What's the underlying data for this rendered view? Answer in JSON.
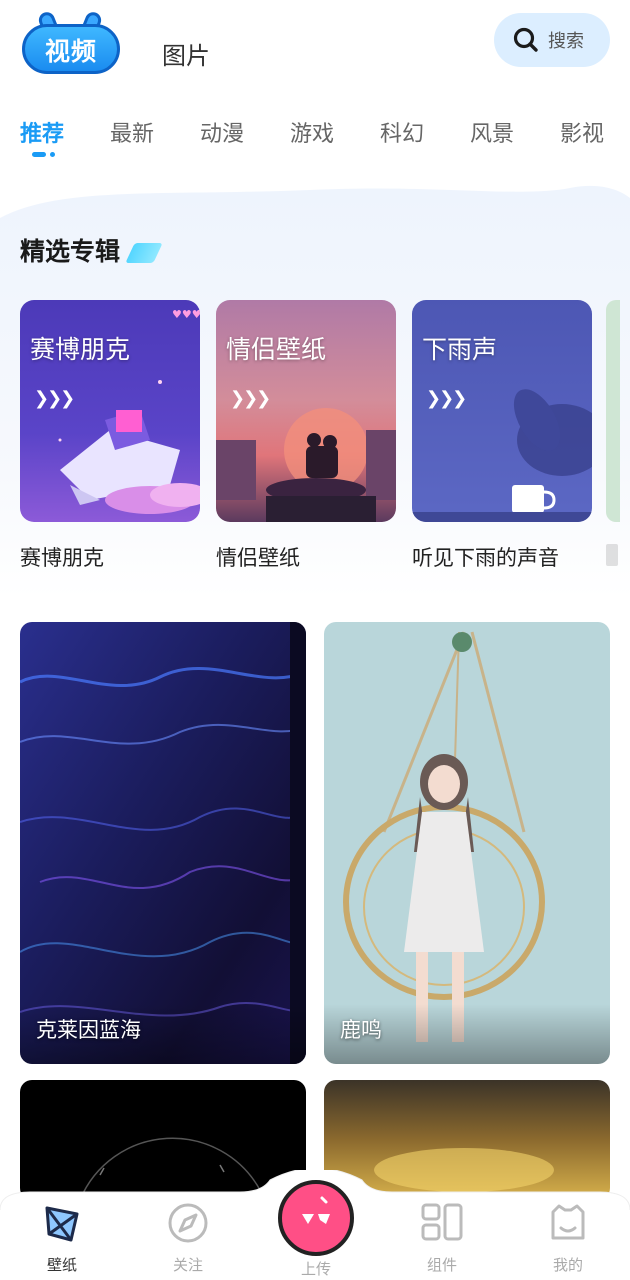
{
  "header": {
    "tab_video": "视频",
    "tab_image": "图片",
    "search_label": "搜索"
  },
  "categories": [
    "推荐",
    "最新",
    "动漫",
    "游戏",
    "科幻",
    "风景",
    "影视"
  ],
  "featured": {
    "title": "精选专辑",
    "albums": [
      {
        "cover_title": "赛博朋克",
        "name": "赛博朋克"
      },
      {
        "cover_title": "情侣壁纸",
        "name": "情侣壁纸"
      },
      {
        "cover_title": "下雨声",
        "name": "听见下雨的声音"
      }
    ]
  },
  "feed": [
    {
      "caption": "克莱因蓝海"
    },
    {
      "caption": "鹿鸣"
    }
  ],
  "bottom_nav": {
    "wallpaper": "壁纸",
    "follow": "关注",
    "upload": "上传",
    "widgets": "组件",
    "mine": "我的"
  },
  "colors": {
    "accent": "#1a9bf5",
    "upload": "#ff4f86",
    "search_bg": "#dceeff"
  }
}
